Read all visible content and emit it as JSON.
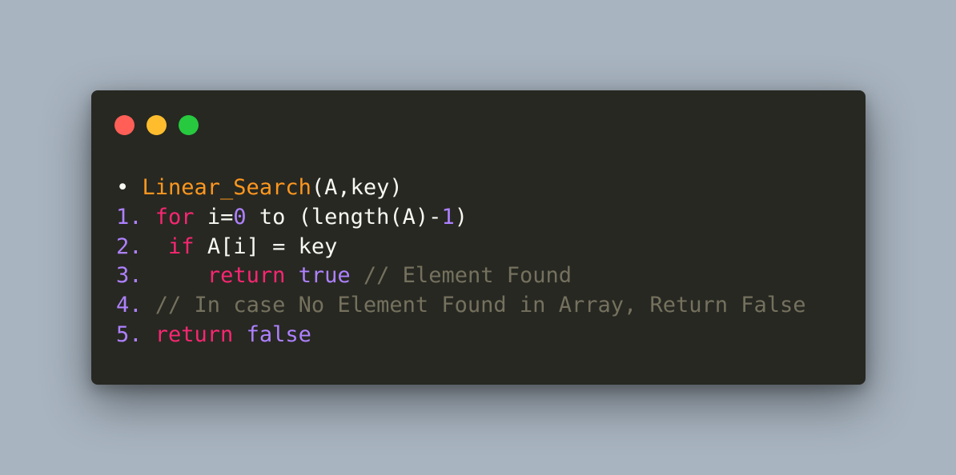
{
  "colors": {
    "background": "#a8b4c0",
    "editor_background": "#272822",
    "control_close": "#ff5f56",
    "control_minimize": "#ffbd2e",
    "control_maximize": "#27c93f",
    "function_name": "#fd971f",
    "keyword": "#f92672",
    "number_literal": "#ae81ff",
    "comment": "#75715e",
    "line_number": "#ae81ff",
    "default_text": "#f8f8f2"
  },
  "window_controls": [
    {
      "name": "close",
      "icon": "red-circle-icon"
    },
    {
      "name": "minimize",
      "icon": "yellow-circle-icon"
    },
    {
      "name": "maximize",
      "icon": "green-circle-icon"
    }
  ],
  "code": {
    "header": {
      "bullet": "• ",
      "function": "Linear_Search",
      "params": "(A,key)"
    },
    "lines": [
      {
        "number": "1. ",
        "tokens": [
          {
            "t": "for",
            "k": "kw"
          },
          {
            "t": " i=",
            "k": "plain"
          },
          {
            "t": "0",
            "k": "num"
          },
          {
            "t": " to (length(A)-",
            "k": "plain"
          },
          {
            "t": "1",
            "k": "num"
          },
          {
            "t": ")",
            "k": "plain"
          }
        ]
      },
      {
        "number": "2. ",
        "tokens": [
          {
            "t": " ",
            "k": "plain"
          },
          {
            "t": "if",
            "k": "kw"
          },
          {
            "t": " A[i] = key",
            "k": "plain"
          }
        ]
      },
      {
        "number": "3. ",
        "tokens": [
          {
            "t": "    ",
            "k": "plain"
          },
          {
            "t": "return",
            "k": "kw"
          },
          {
            "t": " ",
            "k": "plain"
          },
          {
            "t": "true",
            "k": "const"
          },
          {
            "t": " // Element Found",
            "k": "cm"
          }
        ]
      },
      {
        "number": "4. ",
        "tokens": [
          {
            "t": "// In case No Element Found in Array, Return False",
            "k": "cm"
          }
        ]
      },
      {
        "number": "5. ",
        "tokens": [
          {
            "t": "return",
            "k": "kw"
          },
          {
            "t": " ",
            "k": "plain"
          },
          {
            "t": "false",
            "k": "const"
          }
        ]
      }
    ]
  }
}
